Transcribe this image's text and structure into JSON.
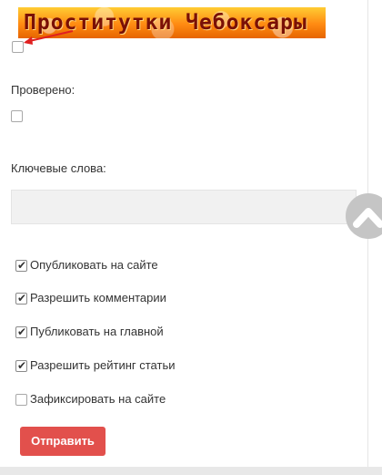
{
  "banner": {
    "text": "Проститутки Чебоксары"
  },
  "fields": {
    "checked_label": "Проверено:",
    "keywords_label": "Ключевые слова:",
    "keywords_value": ""
  },
  "options": [
    {
      "label": "Опубликовать на сайте",
      "checked": true
    },
    {
      "label": "Разрешить комментарии",
      "checked": true
    },
    {
      "label": "Публиковать на главной",
      "checked": true
    },
    {
      "label": "Разрешить рейтинг статьи",
      "checked": true
    },
    {
      "label": "Зафиксировать на сайте",
      "checked": false
    }
  ],
  "submit": {
    "label": "Отправить"
  },
  "colors": {
    "submit_bg": "#e2504c",
    "field_bg": "#f1f1f1",
    "scroll_button": "#c5c5c5",
    "arrow": "#e02020"
  },
  "icons": {
    "scroll_top": "chevron-up-icon",
    "annotation_arrow": "arrow-pointer-icon"
  }
}
